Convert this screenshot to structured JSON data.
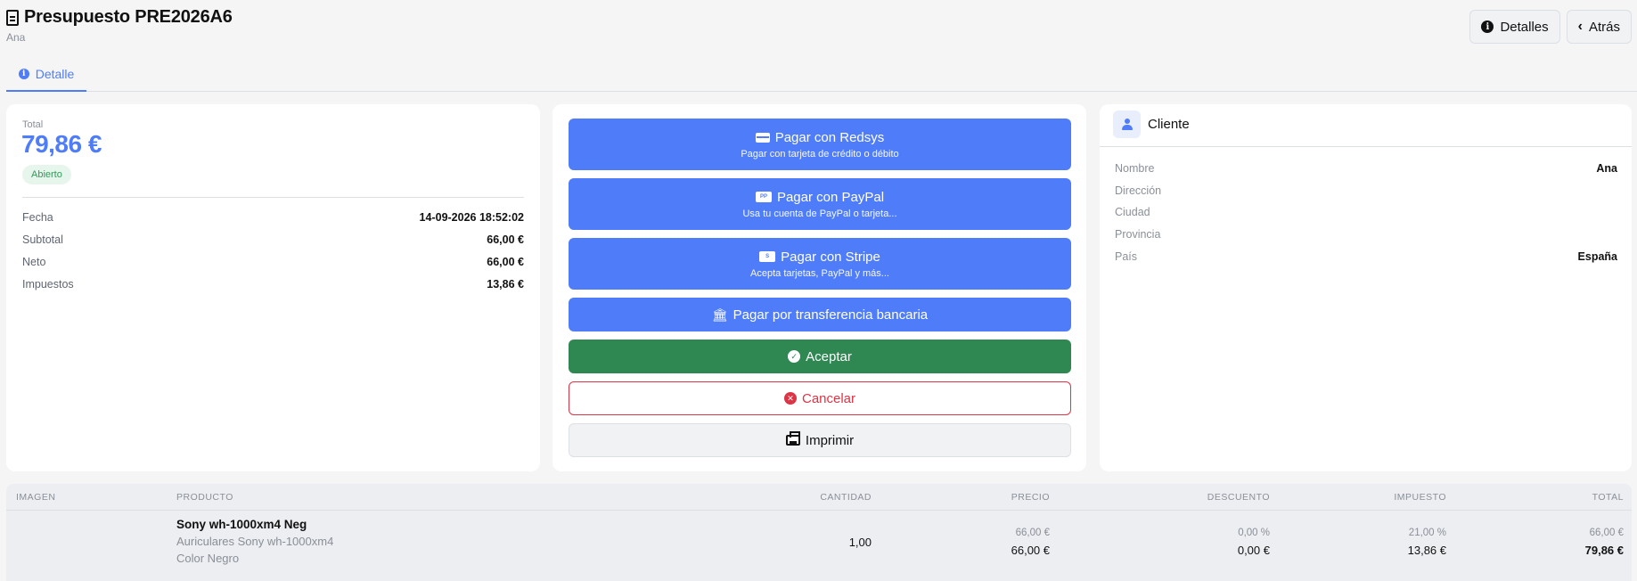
{
  "header": {
    "title": "Presupuesto PRE2026A6",
    "subtitle": "Ana",
    "details_label": "Detalles",
    "back_label": "Atrás"
  },
  "tabs": [
    {
      "label": "Detalle",
      "active": true
    }
  ],
  "summary": {
    "total_label": "Total",
    "total_value": "79,86 €",
    "status": "Abierto",
    "rows": [
      {
        "label": "Fecha",
        "value": "14-09-2026 18:52:02"
      },
      {
        "label": "Subtotal",
        "value": "66,00 €"
      },
      {
        "label": "Neto",
        "value": "66,00 €"
      },
      {
        "label": "Impuestos",
        "value": "13,86 €"
      }
    ]
  },
  "actions": {
    "redsys": {
      "title": "Pagar con Redsys",
      "subtitle": "Pagar con tarjeta de crédito o débito"
    },
    "paypal": {
      "title": "Pagar con PayPal",
      "subtitle": "Usa tu cuenta de PayPal o tarjeta..."
    },
    "stripe": {
      "title": "Pagar con Stripe",
      "subtitle": "Acepta tarjetas, PayPal y más..."
    },
    "transfer": {
      "title": "Pagar por transferencia bancaria"
    },
    "accept": "Aceptar",
    "cancel": "Cancelar",
    "print": "Imprimir"
  },
  "client": {
    "title": "Cliente",
    "rows": [
      {
        "label": "Nombre",
        "value": "Ana"
      },
      {
        "label": "Dirección",
        "value": ""
      },
      {
        "label": "Ciudad",
        "value": ""
      },
      {
        "label": "Provincia",
        "value": ""
      },
      {
        "label": "País",
        "value": "España"
      }
    ]
  },
  "table": {
    "headers": [
      "IMAGEN",
      "PRODUCTO",
      "CANTIDAD",
      "PRECIO",
      "DESCUENTO",
      "IMPUESTO",
      "TOTAL"
    ],
    "rows": [
      {
        "name": "Sony wh-1000xm4 Neg",
        "description": "Auriculares Sony wh-1000xm4",
        "variant": "Color Negro",
        "quantity": "1,00",
        "price_unit": "66,00 €",
        "price_total": "66,00 €",
        "discount_pct": "0,00 %",
        "discount_amount": "0,00 €",
        "tax_pct": "21,00 %",
        "tax_amount": "13,86 €",
        "total_unit": "66,00 €",
        "total": "79,86 €"
      }
    ]
  },
  "colors": {
    "primary": "#4f7df9",
    "success": "#2f8752",
    "danger": "#dc3545",
    "status_bg": "#e6f6ec"
  }
}
